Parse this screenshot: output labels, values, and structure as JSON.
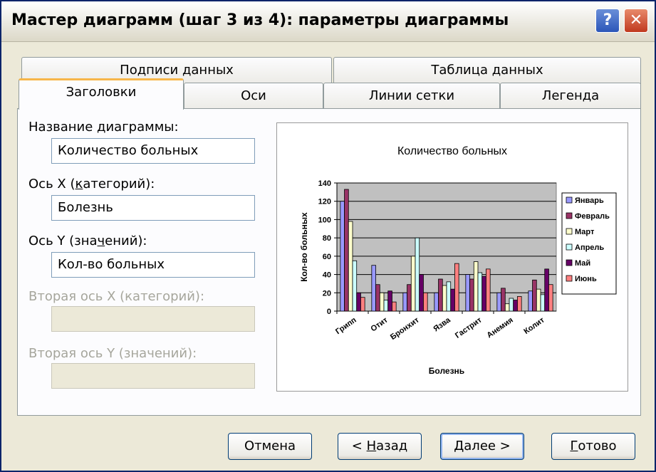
{
  "window": {
    "title": "Мастер диаграмм (шаг 3 из 4): параметры диаграммы",
    "help_label": "?",
    "close_label": "✕"
  },
  "tabs_back": [
    "Подписи данных",
    "Таблица данных"
  ],
  "tabs_front": [
    "Заголовки",
    "Оси",
    "Линии сетки",
    "Легенда"
  ],
  "active_tab": "Заголовки",
  "fields": {
    "chart_title": {
      "label": "Название диаграммы:",
      "value": "Количество больных"
    },
    "x_axis": {
      "label_pre": "Ось X (",
      "label_u": "к",
      "label_post": "атегорий):",
      "value": "Болезнь"
    },
    "y_axis": {
      "label_pre": "Ось Y (зна",
      "label_u": "ч",
      "label_post": "ений):",
      "value": "Кол-во больных"
    },
    "x2_axis": {
      "label": "Вторая ось X (категорий):",
      "value": ""
    },
    "y2_axis": {
      "label": "Вторая ось Y (значений):",
      "value": ""
    }
  },
  "buttons": {
    "cancel": "Отмена",
    "back_pre": "< ",
    "back_u": "Н",
    "back_post": "азад",
    "next_u": "Д",
    "next_post": "алее >",
    "finish_u": "Г",
    "finish_post": "отово"
  },
  "chart_data": {
    "type": "bar",
    "title": "Количество больных",
    "xlabel": "Болезнь",
    "ylabel": "Кол-во больных",
    "ylim": [
      0,
      140
    ],
    "yticks": [
      0,
      20,
      40,
      60,
      80,
      100,
      120,
      140
    ],
    "grid": true,
    "legend_position": "right",
    "categories": [
      "Грипп",
      "Отит",
      "Бронхит",
      "Язва",
      "Гастрит",
      "Анемия",
      "Колит"
    ],
    "series": [
      {
        "name": "Январь",
        "color": "#9999ff",
        "values": [
          120,
          50,
          20,
          20,
          40,
          20,
          22
        ]
      },
      {
        "name": "Февраль",
        "color": "#993366",
        "values": [
          133,
          29,
          29,
          35,
          35,
          25,
          34
        ]
      },
      {
        "name": "Март",
        "color": "#ffffcc",
        "values": [
          98,
          20,
          60,
          28,
          54,
          8,
          24
        ]
      },
      {
        "name": "Апрель",
        "color": "#ccffff",
        "values": [
          55,
          12,
          80,
          32,
          42,
          14,
          18
        ]
      },
      {
        "name": "Май",
        "color": "#660066",
        "values": [
          20,
          22,
          40,
          24,
          38,
          12,
          46
        ]
      },
      {
        "name": "Июнь",
        "color": "#ff8080",
        "values": [
          15,
          10,
          20,
          52,
          46,
          16,
          29
        ]
      }
    ],
    "plot_bg": "#c0c0c0"
  }
}
